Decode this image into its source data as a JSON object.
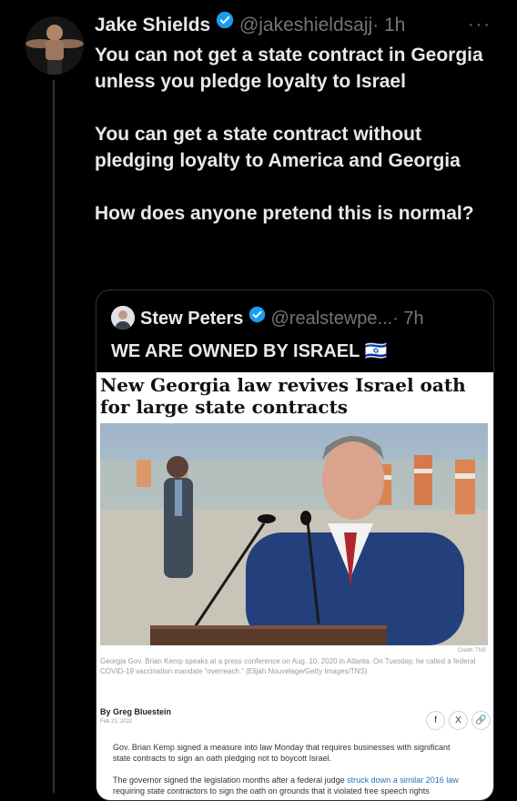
{
  "tweet": {
    "author_name": "Jake Shields",
    "author_handle": "@jakeshieldsajj",
    "time": "· 1h",
    "more": "···",
    "text": "You can not get a state contract in Georgia unless you pledge loyalty to Israel\n\nYou can get a state contract without pledging loyalty to America and Georgia\n\nHow does anyone pretend this is normal?"
  },
  "quote": {
    "author_name": "Stew Peters",
    "author_handle": "@realstewpe...",
    "time": "· 7h",
    "text": "WE ARE OWNED BY ISRAEL",
    "flag": "🇮🇱"
  },
  "article": {
    "title": "New Georgia law revives Israel oath for large state contracts",
    "credit": "Credit: TNS",
    "caption": "Georgia Gov. Brian Kemp speaks at a press conference on Aug. 10, 2020 in Atlanta. On Tuesday, he called a federal COVID-19 vaccination mandate “overreach.” (Elijah Nouvelage/Getty Images/TNS)",
    "byline": "By Greg Bluestein",
    "date": "Feb 21, 2022",
    "share_icons": [
      "f",
      "X",
      "🔗"
    ],
    "para1": "Gov. Brian Kemp signed a measure into law Monday that requires businesses with significant state contracts to sign an oath pledging not to boycott Israel.",
    "para2_start": "The governor signed the legislation months after a federal judge ",
    "para2_link": "struck down a similar 2016 law",
    "para2_end": " requiring state contractors to sign the oath on grounds that it violated free speech rights"
  },
  "colors": {
    "background": "#000000",
    "text": "#e7e9ea",
    "muted": "#71767b",
    "verified": "#1d9bf0",
    "border": "#2f3336"
  }
}
